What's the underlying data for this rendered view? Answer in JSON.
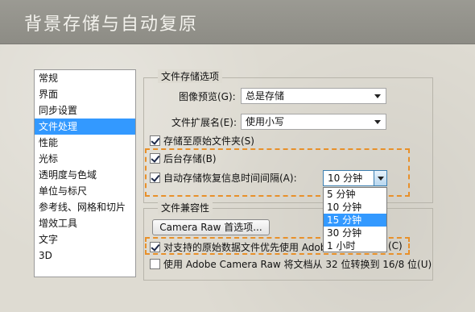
{
  "banner": {
    "title": "背景存储与自动复原"
  },
  "categories": [
    {
      "label": "常规"
    },
    {
      "label": "界面"
    },
    {
      "label": "同步设置"
    },
    {
      "label": "文件处理",
      "selected": true
    },
    {
      "label": "性能"
    },
    {
      "label": "光标"
    },
    {
      "label": "透明度与色域"
    },
    {
      "label": "单位与标尺"
    },
    {
      "label": "参考线、网格和切片"
    },
    {
      "label": "增效工具"
    },
    {
      "label": "文字"
    },
    {
      "label": "3D"
    }
  ],
  "file_save": {
    "group_title": "文件存储选项",
    "image_preview_label": "图像预览(G):",
    "image_preview_value": "总是存储",
    "ext_label": "文件扩展名(E):",
    "ext_value": "使用小写",
    "save_original_folder": "存储至原始文件夹(S)",
    "background_save": "后台存储(B)",
    "auto_save_label": "自动存储恢复信息时间间隔(A):",
    "auto_save_value": "10 分钟",
    "interval_options": [
      "5 分钟",
      "10 分钟",
      "15 分钟",
      "30 分钟",
      "1 小时"
    ]
  },
  "compat": {
    "group_title": "文件兼容性",
    "camera_raw_button": "Camera Raw 首选项...",
    "prefer_acr": "对支持的原始数据文件优先使用 Adob",
    "prefer_acr_tail": "(C)",
    "convert_acr": "使用 Adobe Camera Raw 将文档从 32 位转换到 16/8 位(U)"
  },
  "colors": {
    "accent": "#e8902a",
    "selection": "#3399ff"
  }
}
